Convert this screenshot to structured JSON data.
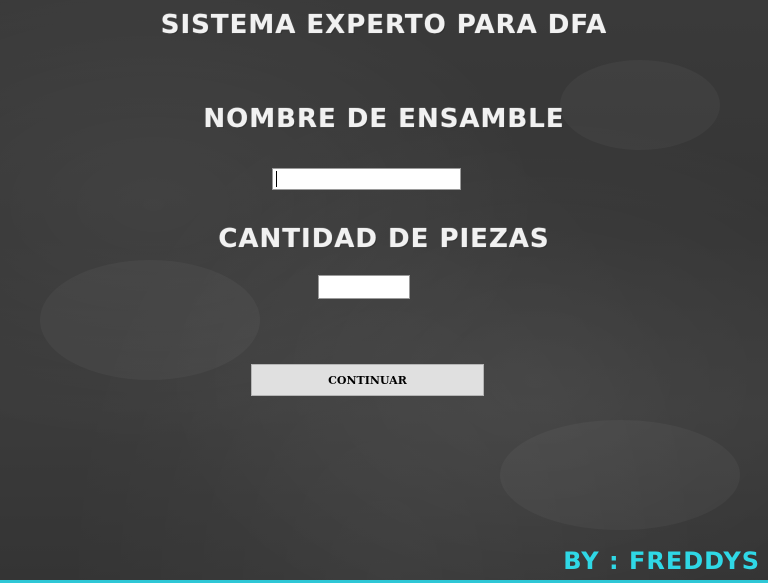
{
  "window": {
    "title": "SISTEMA EXPERTO PARA DFA"
  },
  "form": {
    "ensamble_label": "NOMBRE DE ENSAMBLE",
    "ensamble_value": "",
    "piezas_label": "CANTIDAD DE PIEZAS",
    "piezas_value": "",
    "continue_label": "CONTINUAR"
  },
  "footer": {
    "credit": "BY : FREDDYS"
  },
  "colors": {
    "background": "#383838",
    "chalk_text": "#f1f1f1",
    "credit_text": "#2fd8e6",
    "button_bg": "#e0e0e0"
  }
}
